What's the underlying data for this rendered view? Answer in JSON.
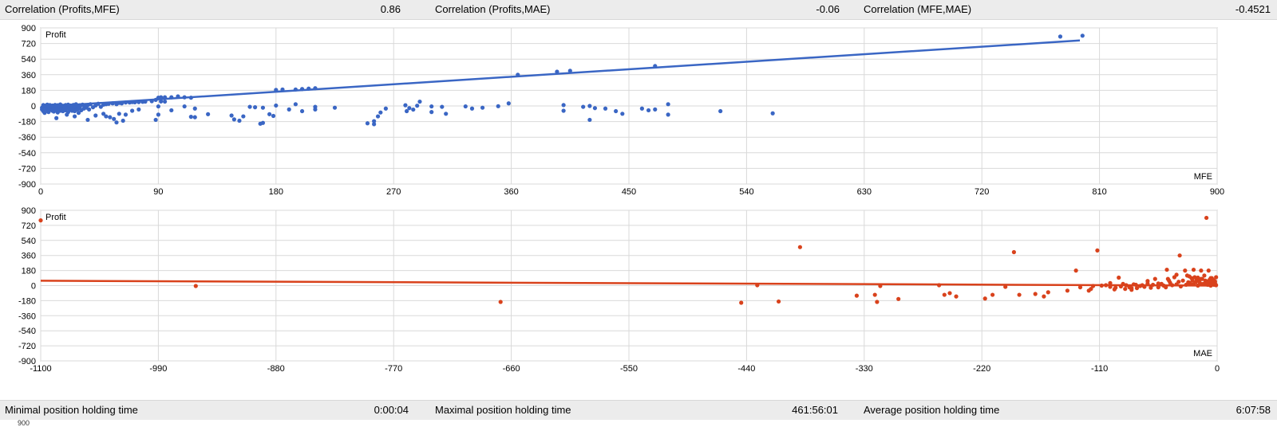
{
  "top_stats": [
    {
      "label": "Correlation (Profits,MFE)",
      "value": "0.86"
    },
    {
      "label": "Correlation (Profits,MAE)",
      "value": "-0.06"
    },
    {
      "label": "Correlation (MFE,MAE)",
      "value": "-0.4521"
    }
  ],
  "bottom_stats": [
    {
      "label": "Minimal position holding time",
      "value": "0:00:04"
    },
    {
      "label": "Maximal position holding time",
      "value": "461:56:01"
    },
    {
      "label": "Average position holding time",
      "value": "6:07:58"
    }
  ],
  "truncated_text": "900",
  "colors": {
    "mfe_series": "#3a66c4",
    "mae_series": "#d9421c",
    "grid": "#d9d9d9",
    "stats_bg": "#ececec"
  },
  "chart_data": [
    {
      "type": "scatter",
      "ylabel": "Profit",
      "xlabel": "MFE",
      "xlim": [
        0,
        900
      ],
      "ylim": [
        -900,
        900
      ],
      "x_ticks": [
        "0",
        "90",
        "180",
        "270",
        "360",
        "450",
        "540",
        "630",
        "720",
        "810",
        "900"
      ],
      "y_ticks": [
        "900",
        "720",
        "540",
        "360",
        "180",
        "0",
        "-180",
        "-360",
        "-540",
        "-720",
        "-900"
      ],
      "trendline": {
        "x": [
          0,
          795
        ],
        "y": [
          -10,
          755
        ]
      },
      "points": [
        [
          1,
          -20
        ],
        [
          1,
          -40
        ],
        [
          2,
          -60
        ],
        [
          2,
          10
        ],
        [
          3,
          -5
        ],
        [
          3,
          -80
        ],
        [
          4,
          -30
        ],
        [
          4,
          5
        ],
        [
          5,
          -50
        ],
        [
          5,
          15
        ],
        [
          6,
          -15
        ],
        [
          6,
          -70
        ],
        [
          7,
          -25
        ],
        [
          7,
          10
        ],
        [
          8,
          -40
        ],
        [
          8,
          -10
        ],
        [
          9,
          -55
        ],
        [
          9,
          5
        ],
        [
          10,
          -20
        ],
        [
          10,
          -65
        ],
        [
          11,
          -35
        ],
        [
          11,
          12
        ],
        [
          12,
          -5
        ],
        [
          12,
          -45
        ],
        [
          13,
          -75
        ],
        [
          13,
          8
        ],
        [
          14,
          -30
        ],
        [
          14,
          -10
        ],
        [
          15,
          -55
        ],
        [
          15,
          18
        ],
        [
          16,
          -20
        ],
        [
          16,
          -40
        ],
        [
          17,
          2
        ],
        [
          17,
          -60
        ],
        [
          18,
          -15
        ],
        [
          18,
          -35
        ],
        [
          19,
          10
        ],
        [
          19,
          -50
        ],
        [
          20,
          -5
        ],
        [
          20,
          -25
        ],
        [
          21,
          -70
        ],
        [
          21,
          15
        ],
        [
          22,
          -30
        ],
        [
          22,
          -10
        ],
        [
          23,
          -45
        ],
        [
          23,
          5
        ],
        [
          24,
          -20
        ],
        [
          24,
          -55
        ],
        [
          25,
          12
        ],
        [
          25,
          -35
        ],
        [
          26,
          -5
        ],
        [
          26,
          -60
        ],
        [
          27,
          -15
        ],
        [
          27,
          20
        ],
        [
          28,
          -40
        ],
        [
          28,
          0
        ],
        [
          29,
          -25
        ],
        [
          29,
          -80
        ],
        [
          30,
          8
        ],
        [
          30,
          -10
        ],
        [
          31,
          -50
        ],
        [
          32,
          15
        ],
        [
          33,
          -30
        ],
        [
          34,
          -5
        ],
        [
          35,
          -20
        ],
        [
          36,
          10
        ],
        [
          37,
          -40
        ],
        [
          38,
          20
        ],
        [
          40,
          -15
        ],
        [
          42,
          5
        ],
        [
          44,
          25
        ],
        [
          46,
          -10
        ],
        [
          48,
          15
        ],
        [
          50,
          20
        ],
        [
          52,
          25
        ],
        [
          55,
          30
        ],
        [
          58,
          20
        ],
        [
          60,
          35
        ],
        [
          62,
          30
        ],
        [
          65,
          40
        ],
        [
          68,
          40
        ],
        [
          70,
          45
        ],
        [
          72,
          42
        ],
        [
          75,
          45
        ],
        [
          78,
          48
        ],
        [
          80,
          50
        ],
        [
          85,
          55
        ],
        [
          90,
          -5
        ],
        [
          92,
          52
        ],
        [
          95,
          50
        ],
        [
          12,
          -140
        ],
        [
          20,
          -100
        ],
        [
          26,
          -120
        ],
        [
          36,
          -160
        ],
        [
          42,
          -110
        ],
        [
          48,
          -90
        ],
        [
          53,
          -130
        ],
        [
          56,
          -150
        ],
        [
          63,
          -170
        ],
        [
          65,
          -100
        ],
        [
          58,
          -190
        ],
        [
          88,
          -160
        ],
        [
          60,
          -90
        ],
        [
          50,
          -120
        ],
        [
          70,
          -55
        ],
        [
          75,
          -40
        ],
        [
          90,
          -100
        ],
        [
          100,
          -50
        ],
        [
          110,
          -5
        ],
        [
          118,
          -30
        ],
        [
          115,
          -125
        ],
        [
          118,
          -130
        ],
        [
          128,
          -95
        ],
        [
          146,
          -110
        ],
        [
          148,
          -155
        ],
        [
          152,
          -170
        ],
        [
          155,
          -120
        ],
        [
          164,
          -15
        ],
        [
          168,
          -205
        ],
        [
          170,
          -195
        ],
        [
          175,
          -95
        ],
        [
          178,
          -115
        ],
        [
          195,
          20
        ],
        [
          210,
          -40
        ],
        [
          250,
          -200
        ],
        [
          255,
          -210
        ],
        [
          255,
          -175
        ],
        [
          258,
          -120
        ],
        [
          260,
          -75
        ],
        [
          264,
          -30
        ],
        [
          279,
          8
        ],
        [
          288,
          3
        ],
        [
          282,
          -25
        ],
        [
          285,
          -42
        ],
        [
          290,
          50
        ],
        [
          299,
          -5
        ],
        [
          307,
          -10
        ],
        [
          325,
          -5
        ],
        [
          338,
          -20
        ],
        [
          358,
          30
        ],
        [
          420,
          0
        ],
        [
          424,
          -25
        ],
        [
          400,
          10
        ],
        [
          480,
          20
        ],
        [
          445,
          -90
        ],
        [
          420,
          -160
        ],
        [
          440,
          -60
        ],
        [
          470,
          -40
        ],
        [
          465,
          -50
        ],
        [
          432,
          -30
        ],
        [
          400,
          -55
        ],
        [
          460,
          -30
        ],
        [
          480,
          -100
        ],
        [
          415,
          -10
        ],
        [
          350,
          -3
        ],
        [
          299,
          -70
        ],
        [
          310,
          -90
        ],
        [
          330,
          -30
        ],
        [
          280,
          -60
        ],
        [
          225,
          -20
        ],
        [
          200,
          -60
        ],
        [
          210,
          -10
        ],
        [
          190,
          -40
        ],
        [
          180,
          5
        ],
        [
          170,
          -20
        ],
        [
          160,
          -10
        ],
        [
          520,
          -60
        ],
        [
          560,
          -85
        ],
        [
          90,
          95
        ],
        [
          95,
          100
        ],
        [
          100,
          100
        ],
        [
          105,
          110
        ],
        [
          110,
          100
        ],
        [
          115,
          95
        ],
        [
          88,
          70
        ],
        [
          92,
          100
        ],
        [
          180,
          185
        ],
        [
          185,
          190
        ],
        [
          195,
          190
        ],
        [
          200,
          195
        ],
        [
          205,
          200
        ],
        [
          210,
          205
        ],
        [
          365,
          360
        ],
        [
          395,
          395
        ],
        [
          405,
          405
        ],
        [
          470,
          460
        ],
        [
          780,
          800
        ],
        [
          797,
          810
        ]
      ]
    },
    {
      "type": "scatter",
      "ylabel": "Profit",
      "xlabel": "MAE",
      "xlim": [
        -1100,
        0
      ],
      "ylim": [
        -900,
        900
      ],
      "x_ticks": [
        "-1100",
        "-990",
        "-880",
        "-770",
        "-660",
        "-550",
        "-440",
        "-330",
        "-220",
        "-110",
        "0"
      ],
      "y_ticks": [
        "900",
        "720",
        "540",
        "360",
        "180",
        "0",
        "-180",
        "-360",
        "-540",
        "-720",
        "-900"
      ],
      "trendline": {
        "x": [
          -1100,
          0
        ],
        "y": [
          58,
          0
        ]
      },
      "points": [
        [
          -1100,
          780
        ],
        [
          -955,
          -5
        ],
        [
          -670,
          -195
        ],
        [
          -445,
          -205
        ],
        [
          -430,
          5
        ],
        [
          -410,
          -190
        ],
        [
          -390,
          460
        ],
        [
          -337,
          -120
        ],
        [
          -320,
          -110
        ],
        [
          -318,
          -195
        ],
        [
          -315,
          -5
        ],
        [
          -298,
          -160
        ],
        [
          -260,
          5
        ],
        [
          -255,
          -110
        ],
        [
          -250,
          -90
        ],
        [
          -244,
          -130
        ],
        [
          -217,
          -155
        ],
        [
          -210,
          -110
        ],
        [
          -198,
          -15
        ],
        [
          -190,
          400
        ],
        [
          -185,
          -110
        ],
        [
          -170,
          -100
        ],
        [
          -162,
          -130
        ],
        [
          -158,
          -80
        ],
        [
          -140,
          -60
        ],
        [
          -132,
          180
        ],
        [
          -128,
          -20
        ],
        [
          -120,
          -60
        ],
        [
          -112,
          420
        ],
        [
          -108,
          0
        ],
        [
          -104,
          5
        ],
        [
          -100,
          -15
        ],
        [
          -95,
          -25
        ],
        [
          -92,
          95
        ],
        [
          -90,
          -10
        ],
        [
          -85,
          5
        ],
        [
          -82,
          -20
        ],
        [
          -78,
          15
        ],
        [
          -75,
          -30
        ],
        [
          -70,
          5
        ],
        [
          -68,
          -15
        ],
        [
          -65,
          25
        ],
        [
          -62,
          -25
        ],
        [
          -60,
          10
        ],
        [
          -58,
          80
        ],
        [
          -55,
          -20
        ],
        [
          -52,
          20
        ],
        [
          -50,
          0
        ],
        [
          -48,
          -20
        ],
        [
          -46,
          80
        ],
        [
          -44,
          35
        ],
        [
          -42,
          5
        ],
        [
          -40,
          100
        ],
        [
          -38,
          15
        ],
        [
          -36,
          45
        ],
        [
          -34,
          -10
        ],
        [
          -32,
          60
        ],
        [
          -30,
          180
        ],
        [
          -29,
          10
        ],
        [
          -28,
          120
        ],
        [
          -27,
          40
        ],
        [
          -26,
          35
        ],
        [
          -25,
          20
        ],
        [
          -24,
          90
        ],
        [
          -23,
          60
        ],
        [
          -22,
          15
        ],
        [
          -21,
          100
        ],
        [
          -20,
          40
        ],
        [
          -19,
          70
        ],
        [
          -18,
          0
        ],
        [
          -17,
          55
        ],
        [
          -16,
          30
        ],
        [
          -15,
          180
        ],
        [
          -14,
          80
        ],
        [
          -13,
          20
        ],
        [
          -12,
          120
        ],
        [
          -11,
          60
        ],
        [
          -10,
          30
        ],
        [
          -9,
          10
        ],
        [
          -8,
          180
        ],
        [
          -7,
          40
        ],
        [
          -6,
          90
        ],
        [
          -5,
          20
        ],
        [
          -4,
          70
        ],
        [
          -3,
          10
        ],
        [
          -2,
          50
        ],
        [
          -1,
          5
        ],
        [
          -1,
          100
        ],
        [
          -2,
          30
        ],
        [
          -3,
          60
        ],
        [
          -4,
          20
        ],
        [
          -5,
          40
        ],
        [
          -6,
          0
        ],
        [
          -7,
          70
        ],
        [
          -8,
          10
        ],
        [
          -9,
          50
        ],
        [
          -10,
          20
        ],
        [
          -35,
          360
        ],
        [
          -22,
          190
        ],
        [
          -10,
          810
        ],
        [
          -47,
          190
        ],
        [
          -38,
          130
        ],
        [
          -12,
          15
        ],
        [
          -18,
          95
        ],
        [
          -45,
          60
        ],
        [
          -26,
          110
        ],
        [
          -15,
          80
        ],
        [
          -5,
          90
        ],
        [
          -55,
          25
        ],
        [
          -65,
          55
        ],
        [
          -72,
          -5
        ],
        [
          -80,
          -30
        ],
        [
          -86,
          -40
        ],
        [
          -96,
          -45
        ],
        [
          -100,
          30
        ],
        [
          -88,
          20
        ],
        [
          -76,
          10
        ],
        [
          -116,
          -5
        ],
        [
          -118,
          -40
        ],
        [
          -80,
          -50
        ]
      ]
    }
  ]
}
